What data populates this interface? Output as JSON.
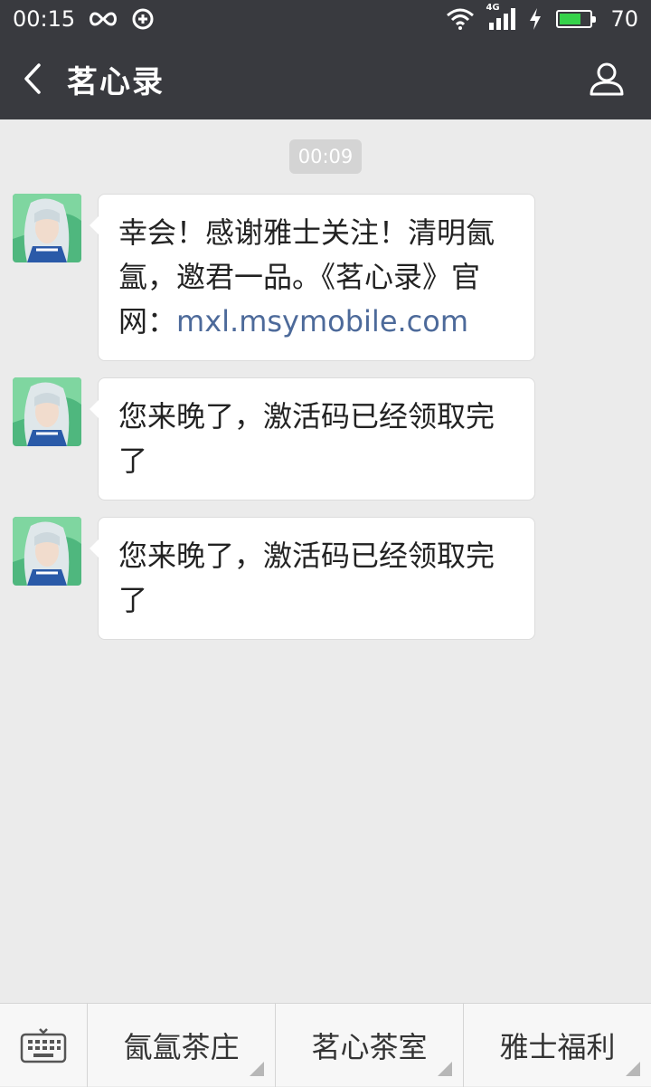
{
  "status_bar": {
    "time": "00:15",
    "network": "4G",
    "battery": "70",
    "battery_level": 0.7
  },
  "header": {
    "title": "茗心录",
    "back_icon": "chevron-left-icon",
    "profile_icon": "person-icon"
  },
  "chat": {
    "timestamp": "00:09",
    "messages": [
      {
        "text": "幸会！感谢雅士关注！清明氤氲，邀君一品。《茗心录》官网：",
        "link": "mxl.msymobile.com"
      },
      {
        "text": "您来晚了，激活码已经领取完了",
        "link": ""
      },
      {
        "text": "您来晚了，激活码已经领取完了",
        "link": ""
      }
    ]
  },
  "bottom_menu": {
    "keyboard_icon": "keyboard-icon",
    "items": [
      {
        "label": "氤氲茶庄"
      },
      {
        "label": "茗心茶室"
      },
      {
        "label": "雅士福利"
      }
    ]
  },
  "colors": {
    "bar_bg": "#393a3f",
    "chat_bg": "#ebebeb",
    "link": "#4d6a9a",
    "battery": "#35d24a"
  }
}
